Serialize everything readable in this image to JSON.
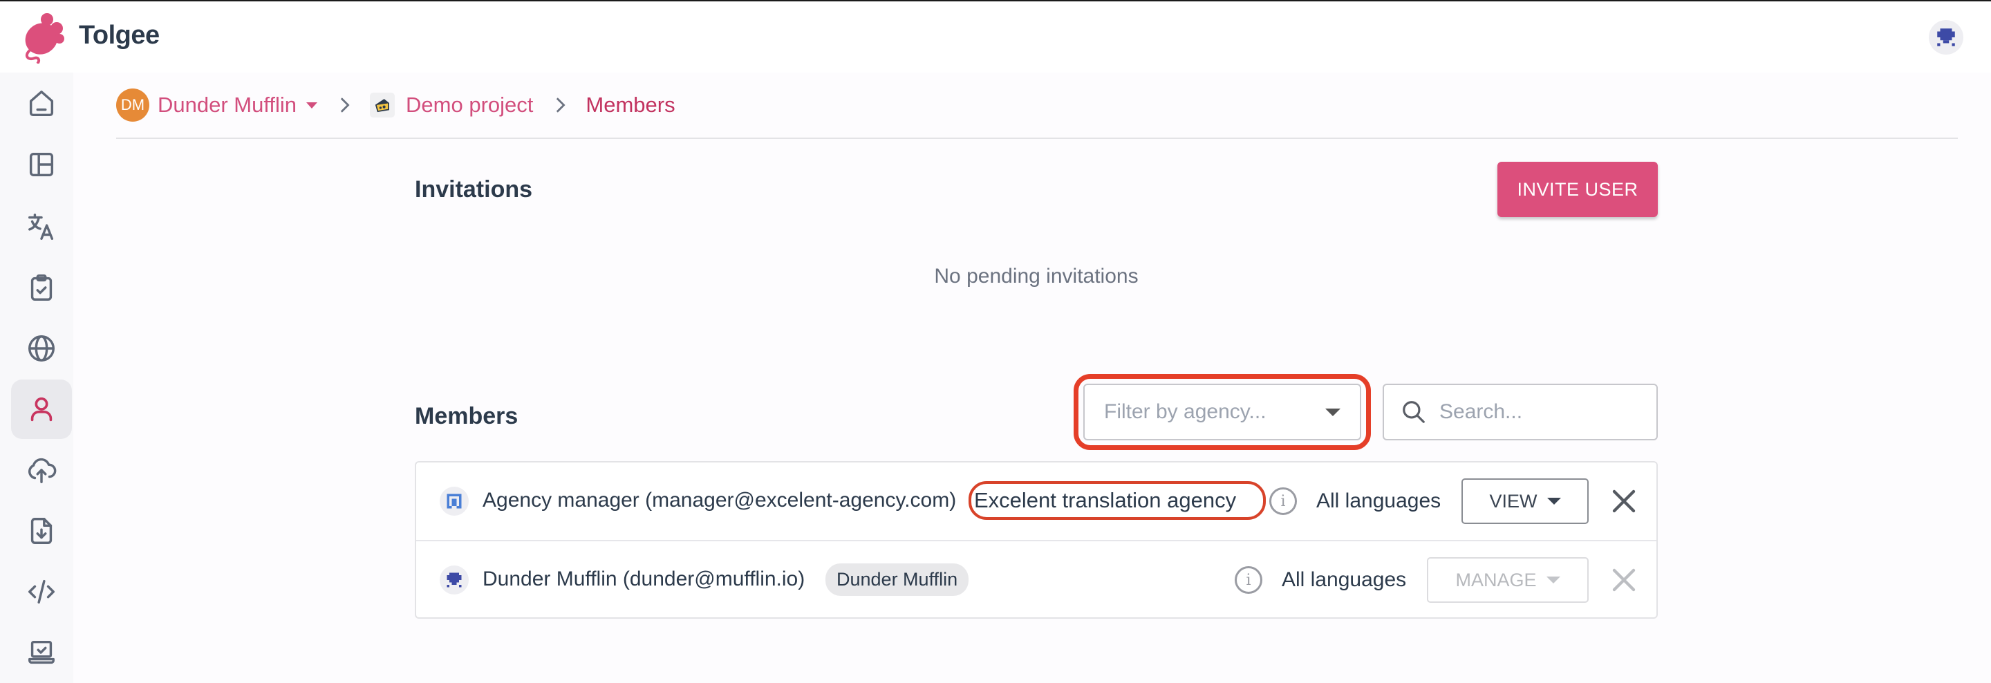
{
  "app": {
    "name": "Tolgee",
    "brand_color": "#dc4f7c"
  },
  "topbar": {
    "user_avatar": "pixel-avatar-icon"
  },
  "sidebar": {
    "items": [
      {
        "id": "home",
        "icon": "home-icon",
        "active": false
      },
      {
        "id": "dashboard",
        "icon": "layout-dashboard-icon",
        "active": false
      },
      {
        "id": "translations",
        "icon": "translate-icon",
        "active": false
      },
      {
        "id": "tasks",
        "icon": "clipboard-check-icon",
        "active": false
      },
      {
        "id": "languages",
        "icon": "globe-icon",
        "active": false
      },
      {
        "id": "members",
        "icon": "user-icon",
        "active": true
      },
      {
        "id": "import",
        "icon": "cloud-upload-icon",
        "active": false
      },
      {
        "id": "export",
        "icon": "file-download-icon",
        "active": false
      },
      {
        "id": "developer",
        "icon": "code-icon",
        "active": false
      },
      {
        "id": "integrate",
        "icon": "laptop-check-icon",
        "active": false
      }
    ]
  },
  "breadcrumb": {
    "org_initials": "DM",
    "org_name": "Dunder Mufflin",
    "project_name": "Demo project",
    "current": "Members"
  },
  "invitations": {
    "title": "Invitations",
    "invite_button": "INVITE USER",
    "empty_message": "No pending invitations"
  },
  "members": {
    "title": "Members",
    "filter_placeholder": "Filter by agency...",
    "search_placeholder": "Search...",
    "rows": [
      {
        "name": "Agency manager (manager@excelent-agency.com)",
        "agency": "Excelent translation agency",
        "organization": null,
        "languages": "All languages",
        "role": "VIEW",
        "role_disabled": false,
        "remove_disabled": false
      },
      {
        "name": "Dunder Mufflin (dunder@mufflin.io)",
        "agency": null,
        "organization": "Dunder Mufflin",
        "languages": "All languages",
        "role": "MANAGE",
        "role_disabled": true,
        "remove_disabled": true
      }
    ]
  },
  "annotations": {
    "highlight_color": "#e53e28"
  }
}
